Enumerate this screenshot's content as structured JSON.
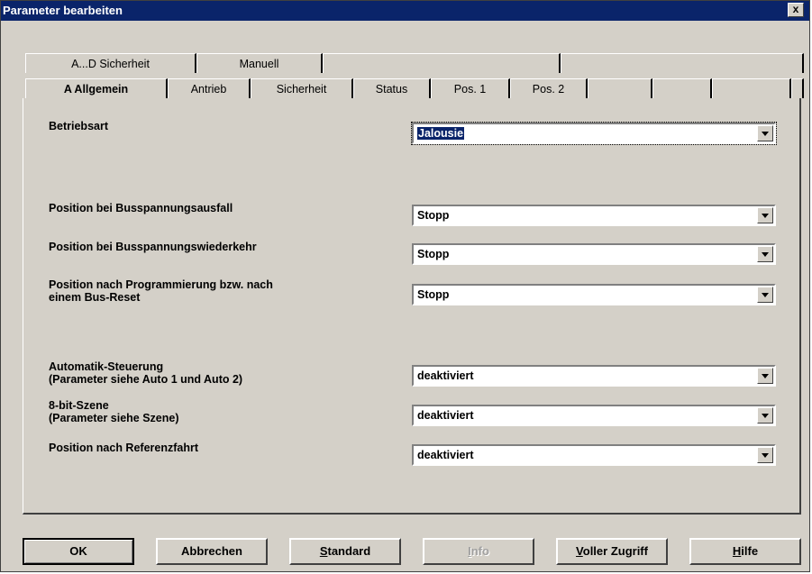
{
  "window": {
    "title": "Parameter bearbeiten",
    "close_label": "x"
  },
  "tabs_back": [
    "A...D  Sicherheit",
    "Manuell"
  ],
  "tabs_front": [
    "A  Allgemein",
    "Antrieb",
    "Sicherheit",
    "Status",
    "Pos. 1",
    "Pos. 2"
  ],
  "params": {
    "betriebsart": {
      "label": "Betriebsart",
      "value": "Jalousie"
    },
    "busausfall": {
      "label": "Position bei Busspannungsausfall",
      "value": "Stopp"
    },
    "buswiederkehr": {
      "label": "Position bei Busspannungswiederkehr",
      "value": "Stopp"
    },
    "programmierung": {
      "label_line1": "Position nach Programmierung bzw. nach",
      "label_line2": "einem Bus-Reset",
      "value": "Stopp"
    },
    "automatik": {
      "label_line1": "Automatik-Steuerung",
      "label_line2": "(Parameter siehe Auto 1 und Auto 2)",
      "value": "deaktiviert"
    },
    "szene": {
      "label_line1": "8-bit-Szene",
      "label_line2": "(Parameter siehe Szene)",
      "value": "deaktiviert"
    },
    "referenzfahrt": {
      "label": "Position nach Referenzfahrt",
      "value": "deaktiviert"
    }
  },
  "buttons": {
    "ok": "OK",
    "abbrechen": "Abbrechen",
    "standard_u": "S",
    "standard_rest": "tandard",
    "info_u": "I",
    "info_rest": "nfo",
    "voller_u": "V",
    "voller_rest": "oller Zugriff",
    "hilfe_u": "H",
    "hilfe_rest": "ilfe"
  }
}
